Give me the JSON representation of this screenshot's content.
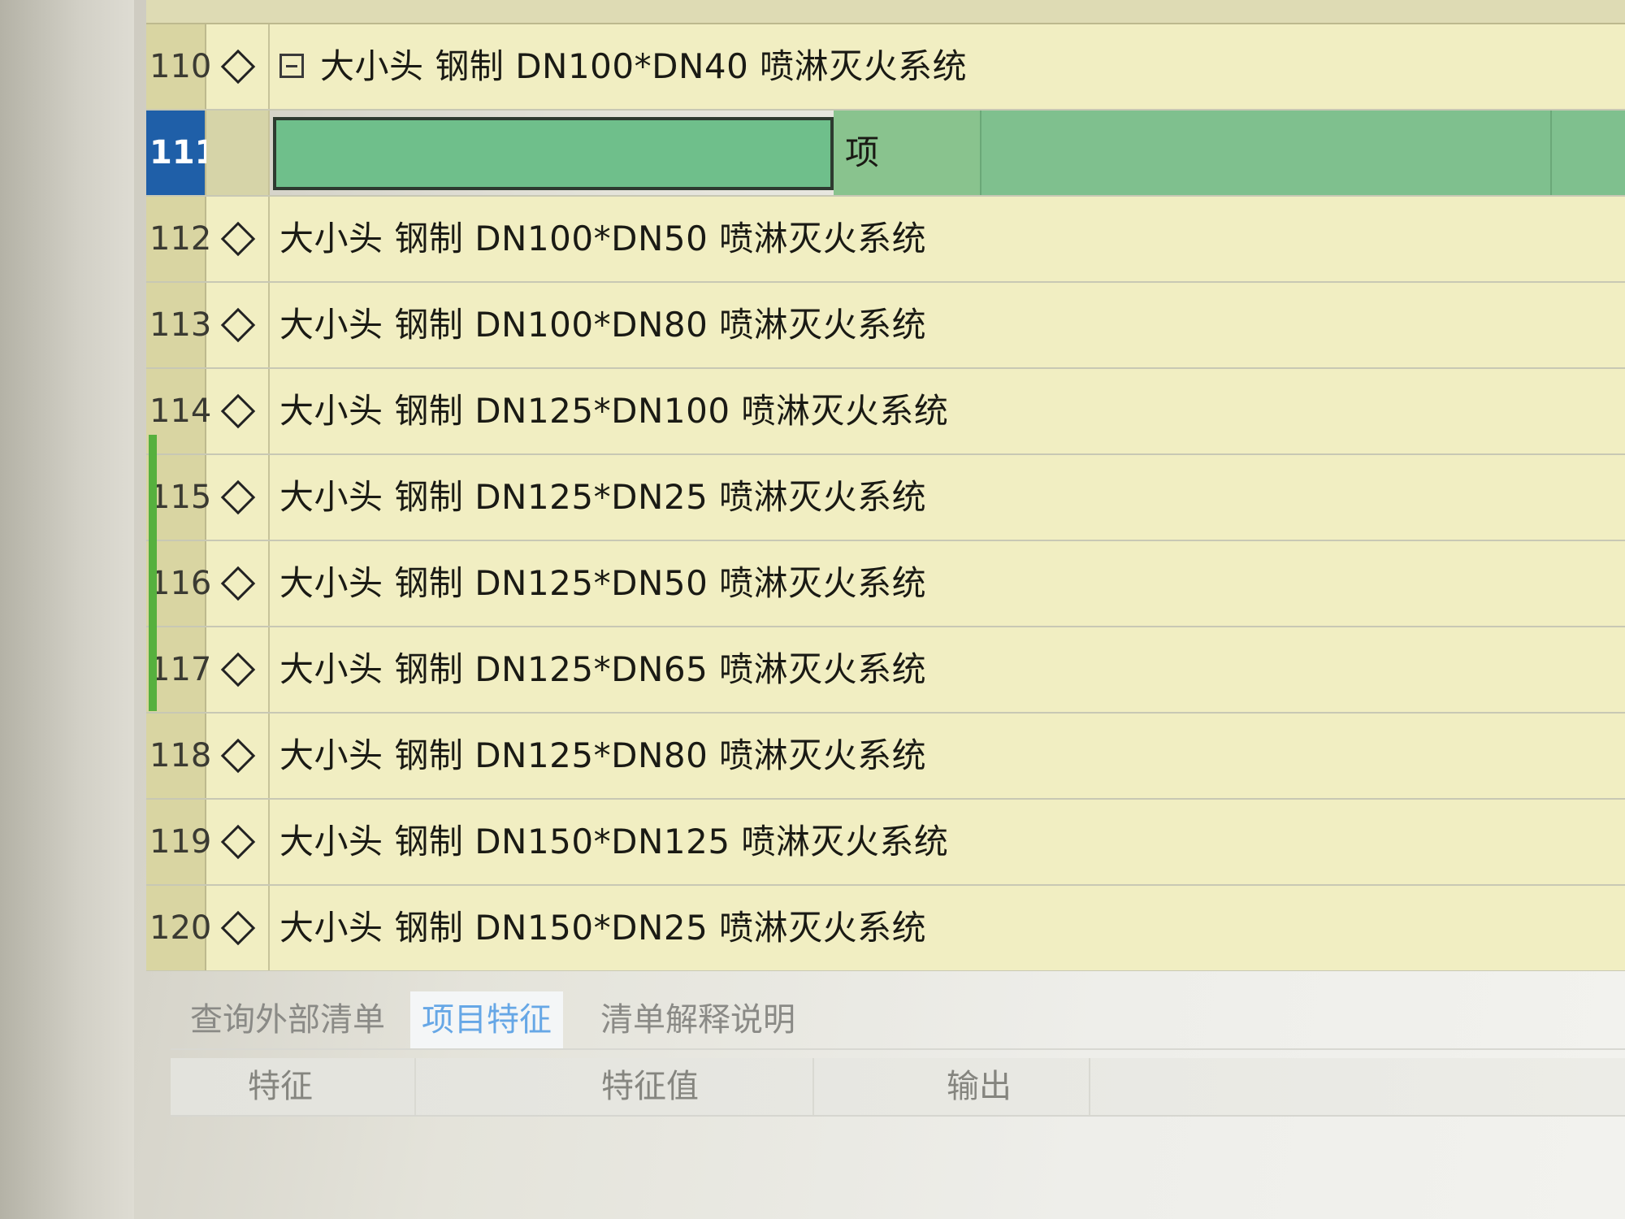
{
  "grid": {
    "rows": [
      {
        "num": "110",
        "text": "大小头 钢制 DN100*DN40 喷淋灭火系统",
        "collapsible": true
      },
      {
        "num": "111",
        "text": "",
        "unit": "项",
        "selected": true
      },
      {
        "num": "112",
        "text": "大小头 钢制 DN100*DN50 喷淋灭火系统"
      },
      {
        "num": "113",
        "text": "大小头 钢制 DN100*DN80 喷淋灭火系统"
      },
      {
        "num": "114",
        "text": "大小头 钢制 DN125*DN100 喷淋灭火系统"
      },
      {
        "num": "115",
        "text": "大小头 钢制 DN125*DN25 喷淋灭火系统"
      },
      {
        "num": "116",
        "text": "大小头 钢制 DN125*DN50 喷淋灭火系统"
      },
      {
        "num": "117",
        "text": "大小头 钢制 DN125*DN65 喷淋灭火系统"
      },
      {
        "num": "118",
        "text": "大小头 钢制 DN125*DN80 喷淋灭火系统"
      },
      {
        "num": "119",
        "text": "大小头 钢制 DN150*DN125 喷淋灭火系统"
      },
      {
        "num": "120",
        "text": "大小头 钢制 DN150*DN25 喷淋灭火系统"
      }
    ]
  },
  "bottom_panel": {
    "tabs": [
      {
        "label": "查询外部清单",
        "active": false
      },
      {
        "label": "项目特征",
        "active": true
      },
      {
        "label": "清单解释说明",
        "active": false
      }
    ],
    "columns": [
      "特征",
      "特征值",
      "输出"
    ]
  },
  "colors": {
    "row_bg": "#f1eec2",
    "selected_row_num": "#1f5fa8",
    "edit_cell": "#6fbf8b",
    "active_tab": "#66a7e6"
  },
  "icons": {
    "row_marker": "diamond-icon",
    "collapse": "collapse-minus-icon"
  }
}
